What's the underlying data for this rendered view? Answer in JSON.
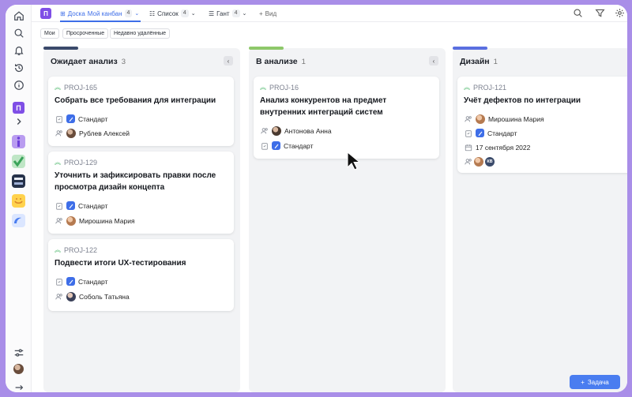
{
  "workspace": {
    "badge": "П"
  },
  "topbar": {
    "project_badge": "П",
    "tabs": [
      {
        "label": "Доска",
        "sublabel": "Мой канбан",
        "count": "4",
        "icon": "board-icon"
      },
      {
        "label": "Список",
        "count": "4",
        "icon": "list-icon"
      },
      {
        "label": "Гант",
        "count": "4",
        "icon": "gantt-icon"
      },
      {
        "label": "Вид",
        "icon": "plus-icon"
      }
    ]
  },
  "filters": [
    "Мои",
    "Просроченные",
    "Недавно удалённые"
  ],
  "columns": [
    {
      "title": "Ожидает анализ",
      "count": "3",
      "accent": "#3b4a6b",
      "cards": [
        {
          "key": "PROJ-165",
          "title": [
            "Собрать все требования для интеграции"
          ],
          "type": "Стандарт",
          "assignee": "Рублев Алексей"
        },
        {
          "key": "PROJ-129",
          "title": [
            "Уточнить и зафиксировать правки после",
            "просмотра дизайн концепта"
          ],
          "type": "Стандарт",
          "assignee": "Мирошина Мария"
        },
        {
          "key": "PROJ-122",
          "title": [
            "Подвести итоги UX-тестирования"
          ],
          "type": "Стандарт",
          "assignee": "Соболь Татьяна"
        }
      ]
    },
    {
      "title": "В анализе",
      "count": "1",
      "accent": "#8ec86a",
      "cards": [
        {
          "key": "PROJ-16",
          "title": [
            "Анализ конкурентов на предмет",
            "внутренних интеграций систем"
          ],
          "assignee": "Антонова Анна",
          "type": "Стандарт"
        }
      ]
    },
    {
      "title": "Дизайн",
      "count": "1",
      "accent": "#5a6fe0",
      "cards": [
        {
          "key": "PROJ-121",
          "title": [
            "Учёт дефектов по интеграции"
          ],
          "assignee": "Мирошина Мария",
          "type": "Стандарт",
          "date": "17 сентября 2022",
          "extra_avatar": "КВ"
        }
      ]
    }
  ],
  "add_button": {
    "label": "Задача"
  }
}
